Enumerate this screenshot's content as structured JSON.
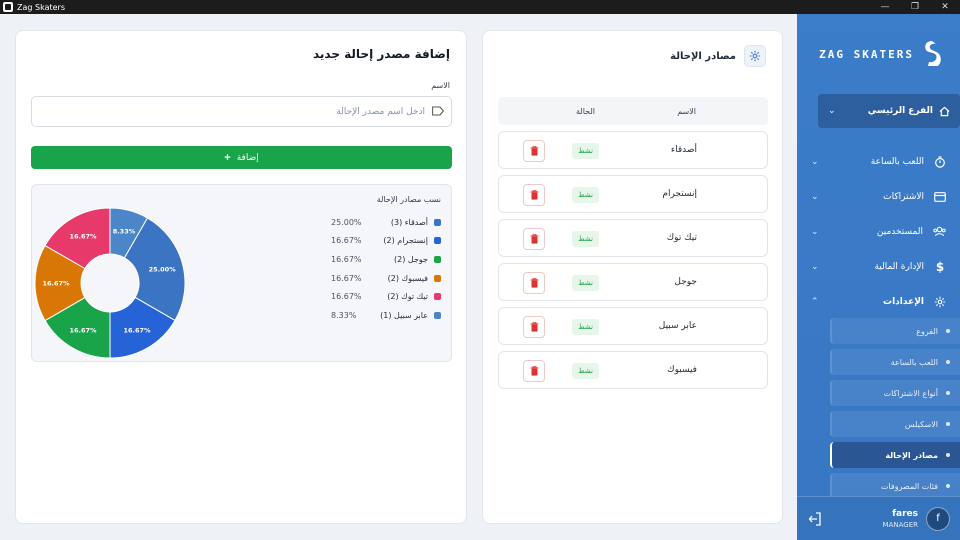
{
  "window": {
    "title": "Zag Skaters"
  },
  "brand": {
    "name": "ZAG SKATERS"
  },
  "sidebar": {
    "branch": "الفرع الرئيسي",
    "items": [
      {
        "label": "اللعب بالساعة",
        "icon": "timer-icon"
      },
      {
        "label": "الاشتراكات",
        "icon": "card-icon"
      },
      {
        "label": "المستخدمين",
        "icon": "users-icon"
      },
      {
        "label": "الإدارة المالية",
        "icon": "dollar-icon"
      },
      {
        "label": "الإعدادات",
        "icon": "gear-icon"
      }
    ],
    "submenu": [
      {
        "label": "الفروع"
      },
      {
        "label": "اللعب بالساعة"
      },
      {
        "label": "أنواع الاشتراكات"
      },
      {
        "label": "الاسكيلس"
      },
      {
        "label": "مصادر الإحالة"
      },
      {
        "label": "فئات المصروفات"
      }
    ]
  },
  "user": {
    "name": "fares",
    "role": "MANAGER",
    "initial": "f"
  },
  "list": {
    "title": "مصادر الإحالة",
    "columns": {
      "name": "الاسم",
      "status": "الحالة"
    },
    "rows": [
      {
        "name": "أصدقاء",
        "status": "نشط"
      },
      {
        "name": "إنستجرام",
        "status": "نشط"
      },
      {
        "name": "تيك توك",
        "status": "نشط"
      },
      {
        "name": "جوجل",
        "status": "نشط"
      },
      {
        "name": "عابر سبيل",
        "status": "نشط"
      },
      {
        "name": "فيسبوك",
        "status": "نشط"
      }
    ]
  },
  "form": {
    "title": "إضافة مصدر إحالة جديد",
    "name_label": "الاسم",
    "name_placeholder": "أدخل اسم مصدر الإحالة",
    "name_value": "",
    "add_label": "إضافة"
  },
  "chart_data": {
    "type": "pie",
    "title": "نسب مصادر الإحالة",
    "slices": [
      {
        "label": "أصدقاء (3)",
        "value": 25.0,
        "pct": "25.00%",
        "color": "#3b74c2"
      },
      {
        "label": "إنستجرام (2)",
        "value": 16.67,
        "pct": "16.67%",
        "color": "#2563d6"
      },
      {
        "label": "جوجل (2)",
        "value": 16.67,
        "pct": "16.67%",
        "color": "#19a44a"
      },
      {
        "label": "فيسبوك (2)",
        "value": 16.67,
        "pct": "16.67%",
        "color": "#d97706"
      },
      {
        "label": "تيك توك (2)",
        "value": 16.67,
        "pct": "16.67%",
        "color": "#e8396b"
      },
      {
        "label": "عابر سبيل (1)",
        "value": 8.33,
        "pct": "8.33%",
        "color": "#4a86c8"
      }
    ]
  },
  "colors": {
    "sidebar": "#3b7dc9",
    "accent_green": "#19a44a",
    "active_badge": "#22a046",
    "delete": "#d33"
  }
}
